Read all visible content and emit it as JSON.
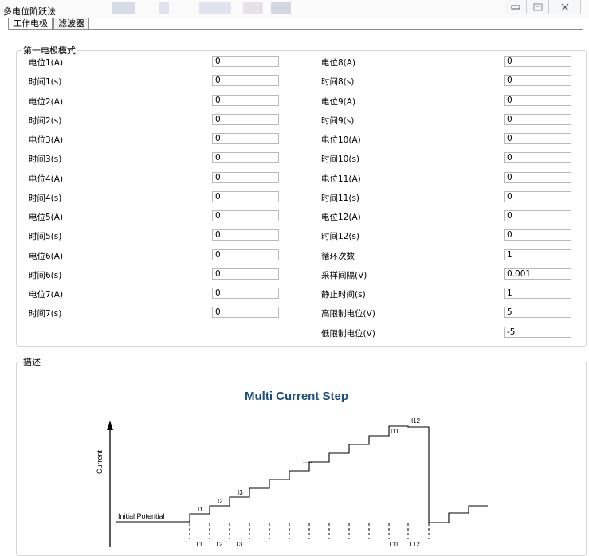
{
  "window": {
    "title": "多电位阶跃法"
  },
  "tabs": [
    {
      "label": "工作电极",
      "active": true
    },
    {
      "label": "滤波器",
      "active": false
    }
  ],
  "group1": {
    "legend": "第一电极模式",
    "left": [
      {
        "label": "电位1(A)",
        "value": "0"
      },
      {
        "label": "时间1(s)",
        "value": "0"
      },
      {
        "label": "电位2(A)",
        "value": "0"
      },
      {
        "label": "时间2(s)",
        "value": "0"
      },
      {
        "label": "电位3(A)",
        "value": "0"
      },
      {
        "label": "时间3(s)",
        "value": "0"
      },
      {
        "label": "电位4(A)",
        "value": "0"
      },
      {
        "label": "时间4(s)",
        "value": "0"
      },
      {
        "label": "电位5(A)",
        "value": "0"
      },
      {
        "label": "时间5(s)",
        "value": "0"
      },
      {
        "label": "电位6(A)",
        "value": "0"
      },
      {
        "label": "时间6(s)",
        "value": "0"
      },
      {
        "label": "电位7(A)",
        "value": "0"
      },
      {
        "label": "时间7(s)",
        "value": "0"
      }
    ],
    "right": [
      {
        "label": "电位8(A)",
        "value": "0"
      },
      {
        "label": "时间8(s)",
        "value": "0"
      },
      {
        "label": "电位9(A)",
        "value": "0"
      },
      {
        "label": "时间9(s)",
        "value": "0"
      },
      {
        "label": "电位10(A)",
        "value": "0"
      },
      {
        "label": "时间10(s)",
        "value": "0"
      },
      {
        "label": "电位11(A)",
        "value": "0"
      },
      {
        "label": "时间11(s)",
        "value": "0"
      },
      {
        "label": "电位12(A)",
        "value": "0"
      },
      {
        "label": "时间12(s)",
        "value": "0"
      },
      {
        "label": "循环次数",
        "value": "1"
      },
      {
        "label": "采样间隔(V)",
        "value": "0.001"
      },
      {
        "label": "静止时间(s)",
        "value": "1"
      },
      {
        "label": "高限制电位(V)",
        "value": "5"
      },
      {
        "label": "低限制电位(V)",
        "value": "-5"
      }
    ]
  },
  "group2": {
    "legend": "描述",
    "diagram": {
      "title": "Multi Current Step",
      "y_axis": "Current",
      "initial": "Initial Potential",
      "steps": [
        "I1",
        "I2",
        "I3",
        "I11",
        "I12"
      ],
      "times": [
        "T1",
        "T2",
        "T3",
        "T11",
        "T12"
      ],
      "ellipsis": "......"
    }
  },
  "colors": {
    "diagram_title": "#1f4e79"
  }
}
